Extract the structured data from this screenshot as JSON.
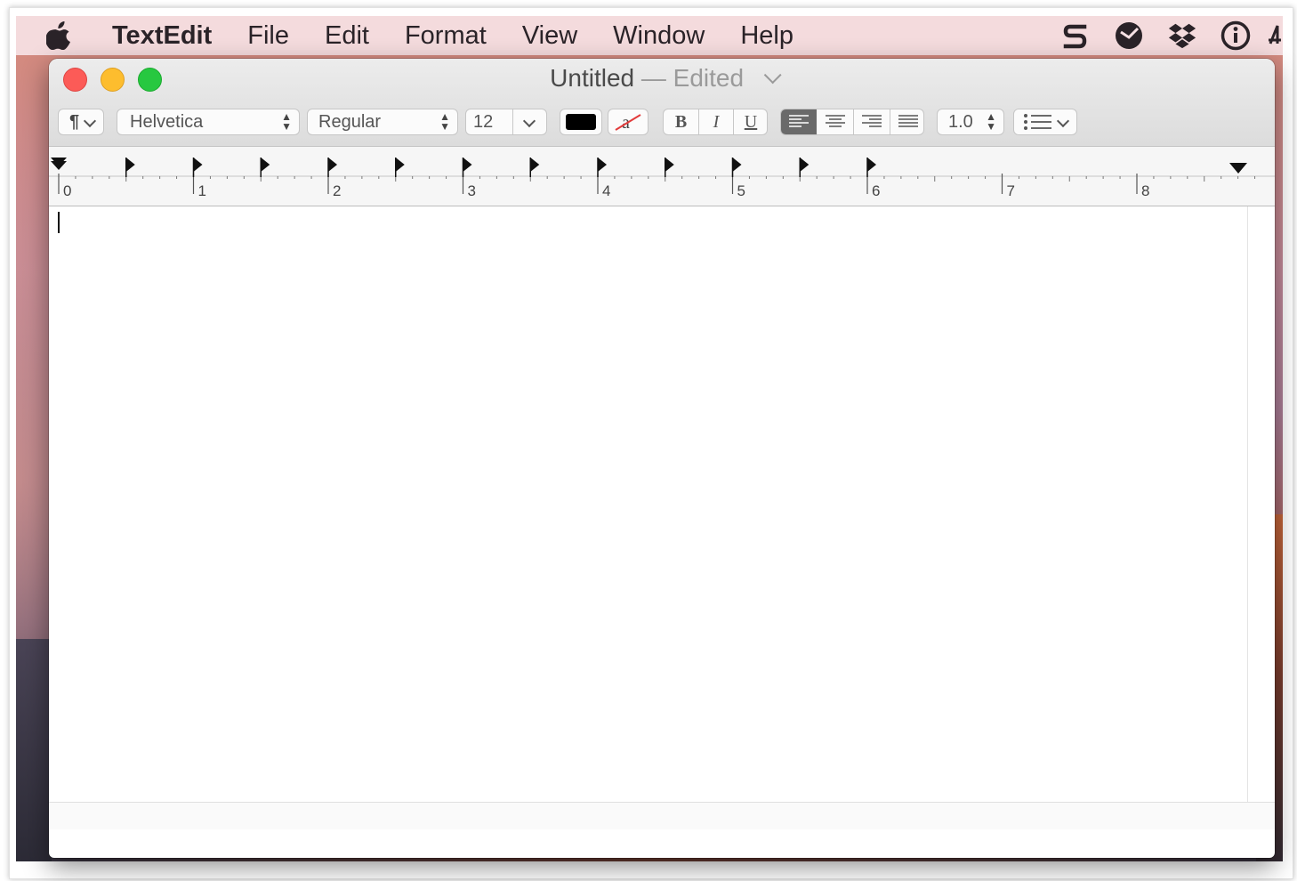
{
  "menubar": {
    "app_name": "TextEdit",
    "items": [
      "File",
      "Edit",
      "Format",
      "View",
      "Window",
      "Help"
    ],
    "status_icons": [
      "s-sync-icon",
      "clock-icon",
      "dropbox-icon",
      "info-icon"
    ]
  },
  "window": {
    "title": "Untitled",
    "separator": "—",
    "edited_label": "Edited"
  },
  "toolbar": {
    "paragraph_style_glyph": "¶",
    "font_family": "Helvetica",
    "font_style": "Regular",
    "font_size": "12",
    "line_spacing": "1.0",
    "text_color": "#000000",
    "bold_label": "B",
    "italic_label": "I",
    "underline_label": "U",
    "alignment_selected": "left"
  },
  "ruler": {
    "numbers": [
      "0",
      "1",
      "2",
      "3",
      "4",
      "5",
      "6",
      "7",
      "8"
    ]
  },
  "document": {
    "text": ""
  }
}
